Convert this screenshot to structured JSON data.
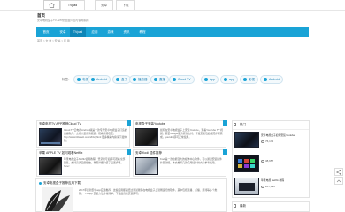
{
  "nav": {
    "tabs": [
      {
        "label": "TVpad"
      },
      {
        "label": "安卓"
      },
      {
        "label": "下载"
      }
    ]
  },
  "header": {
    "title": "首页",
    "subtitle": "安卓电视盒子TV APP的全面介绍与使用指南"
  },
  "menu": {
    "items": [
      {
        "label": "首页"
      },
      {
        "label": "安卓"
      },
      {
        "label": "TVpad"
      },
      {
        "label": "应用"
      },
      {
        "label": "游戏"
      },
      {
        "label": "资讯"
      },
      {
        "label": "教程"
      }
    ]
  },
  "breadcrumb": "首页 > 文 章 > 安 卓 > 应 用",
  "tags": {
    "label": "标签：",
    "items": [
      {
        "label": "电视"
      },
      {
        "label": "Android"
      },
      {
        "label": "盒子"
      },
      {
        "label": "播放器"
      },
      {
        "label": "直播"
      },
      {
        "label": "Cloud TV"
      },
      {
        "label": "App"
      },
      {
        "label": "app"
      },
      {
        "label": "影视"
      },
      {
        "label": "Android"
      }
    ]
  },
  "cards": [
    {
      "title": "安卓电视TV APP推荐Cloud TV",
      "text": "Cloud TV云电视Android版是一款专为安卓电视盒子打造的直播软件，支持大量高清频道，观看流畅稳定，http://www.li3weeb.com/2fdd_html 更多精彩内容请下载体验。"
    },
    {
      "title": "电视盒子安装Youtube",
      "text": "如何在安卓电视盒子上安装Youtube，观看YouTube TV 视频，需要Google服务框架支持，下载安装包后按照步骤完成，youtube即可正常使用。"
    },
    {
      "title": "苹果 APPLE TV 如何观看Netflix",
      "text": "苹果电视盒子Netflix使用教程，登录账号后即可观看全部剧集，支持高清画质播放，教程详细介绍了设置步骤，here!"
    },
    {
      "title": "安卓 Kodi 插件推荐",
      "text": "Kodi是一款功能强大的媒体中心软件，可以通过安装插件扩展功能，本文推荐几款实用插件供大家参考使用。"
    }
  ],
  "sidebar": {
    "hot_title": "热门",
    "items": [
      {
        "title": "安卓电视盒子如何安装Youtube",
        "views": "76,172"
      },
      {
        "title": "电视盒子直播软件推荐",
        "views": "38,957"
      },
      {
        "title": "苹果电视 Netflix 教程",
        "views": "207,996"
      }
    ],
    "latest_title": "最新"
  },
  "article": {
    "title": "安卓电视盒子推荐应用下载",
    "text": "2017年最新安卓app应用推荐，这些应用都是经过测试能够在电视盒子上流畅运行的软件，其中包括直播、点播、游戏等多个类别，“TV App”安装方法非常简单，下载后直接安装即可。"
  },
  "colors": {
    "accent": "#1aa3d6",
    "accent_dark": "#0d86b8",
    "border": "#e3e3e3"
  }
}
